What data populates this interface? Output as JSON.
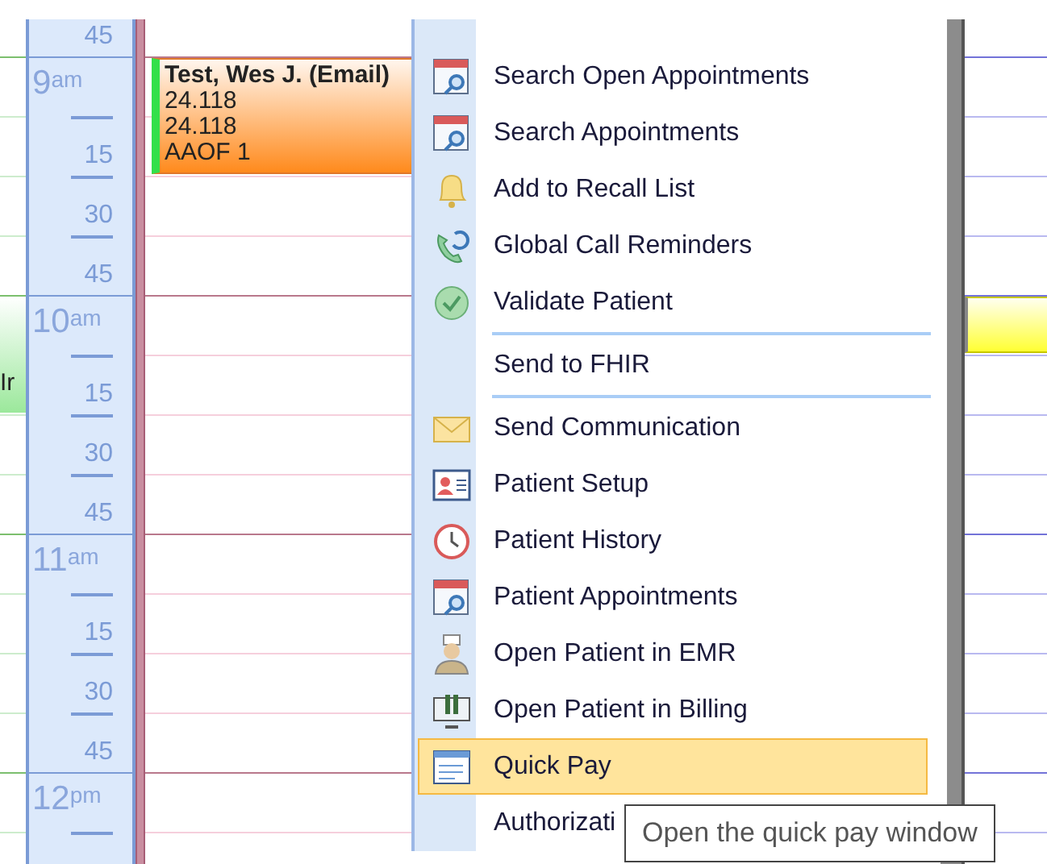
{
  "time_slots": [
    {
      "label": "45"
    },
    {
      "label": "9",
      "suffix": "am"
    },
    {
      "label": "15"
    },
    {
      "label": "30"
    },
    {
      "label": "45"
    },
    {
      "label": "10",
      "suffix": "am"
    },
    {
      "label": "15"
    },
    {
      "label": "30"
    },
    {
      "label": "45"
    },
    {
      "label": "11",
      "suffix": "am"
    },
    {
      "label": "15"
    },
    {
      "label": "30"
    },
    {
      "label": "45"
    },
    {
      "label": "12",
      "suffix": "pm"
    }
  ],
  "left_column": {
    "appointments": [
      {
        "lines": [
          "Ir"
        ],
        "color": "#9be89b"
      }
    ]
  },
  "day_column": {
    "appointments": [
      {
        "lines": [
          "Test, Wes J. (Email)",
          "24.118",
          "24.118",
          "AAOF 1"
        ],
        "color": "#ff8a1c"
      }
    ]
  },
  "right_column": {
    "appointments": [
      {
        "color": "#ffff33"
      }
    ]
  },
  "context_menu": {
    "items": [
      {
        "kind": "item",
        "label": "Search Open Appointments",
        "selected": false
      },
      {
        "kind": "item",
        "label": "Search Appointments",
        "selected": false
      },
      {
        "kind": "item",
        "label": "Add to Recall List",
        "selected": false
      },
      {
        "kind": "item",
        "label": "Global Call Reminders",
        "selected": false
      },
      {
        "kind": "item",
        "label": "Validate Patient",
        "selected": false
      },
      {
        "kind": "separator"
      },
      {
        "kind": "item",
        "label": "Send to FHIR",
        "selected": false
      },
      {
        "kind": "separator"
      },
      {
        "kind": "item",
        "label": "Send Communication",
        "selected": false
      },
      {
        "kind": "item",
        "label": "Patient Setup",
        "selected": false
      },
      {
        "kind": "item",
        "label": "Patient History",
        "selected": false
      },
      {
        "kind": "item",
        "label": "Patient Appointments",
        "selected": false
      },
      {
        "kind": "item",
        "label": "Open Patient in EMR",
        "selected": false
      },
      {
        "kind": "item",
        "label": "Open Patient in Billing",
        "selected": false
      },
      {
        "kind": "item",
        "label": "Quick Pay",
        "selected": true
      },
      {
        "kind": "item",
        "label": "Authorizati",
        "selected": false
      }
    ]
  },
  "tooltip": {
    "text": "Open the quick pay window"
  }
}
